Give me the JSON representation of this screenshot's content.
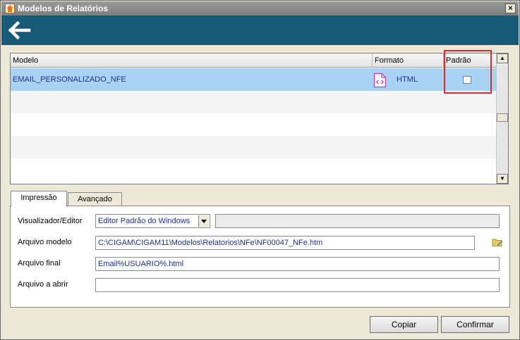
{
  "window": {
    "title": "Modelos de Relatórios",
    "close_label": "×"
  },
  "header": {
    "back_icon": "arrow-left-icon"
  },
  "grid": {
    "columns": [
      "Modelo",
      "Formato",
      "Padrão"
    ],
    "rows": [
      {
        "modelo": "EMAIL_PERSONALIZADO_NFE",
        "formato": "HTML",
        "padrao_checked": false,
        "format_icon": "html-document-icon"
      }
    ]
  },
  "tabs": [
    {
      "label": "Impressão",
      "active": true
    },
    {
      "label": "Avançado",
      "active": false
    }
  ],
  "form": {
    "visualizador": {
      "label": "Visualizador/Editor",
      "value": "Editor Padrão do Windows"
    },
    "arquivo_modelo": {
      "label": "Arquivo modelo",
      "value": "C:\\CIGAM\\CIGAM11\\Modelos\\Relatorios\\NFe\\NF00047_NFe.htm"
    },
    "arquivo_final": {
      "label": "Arquivo final",
      "value": "Email%USUARIO%.html"
    },
    "arquivo_abrir": {
      "label": "Arquivo a abrir",
      "value": ""
    }
  },
  "buttons": {
    "copiar": "Copiar",
    "confirmar": "Confirmar"
  },
  "colors": {
    "header": "#165a78",
    "selection": "#a9d3f5",
    "highlight": "#e0272a"
  }
}
